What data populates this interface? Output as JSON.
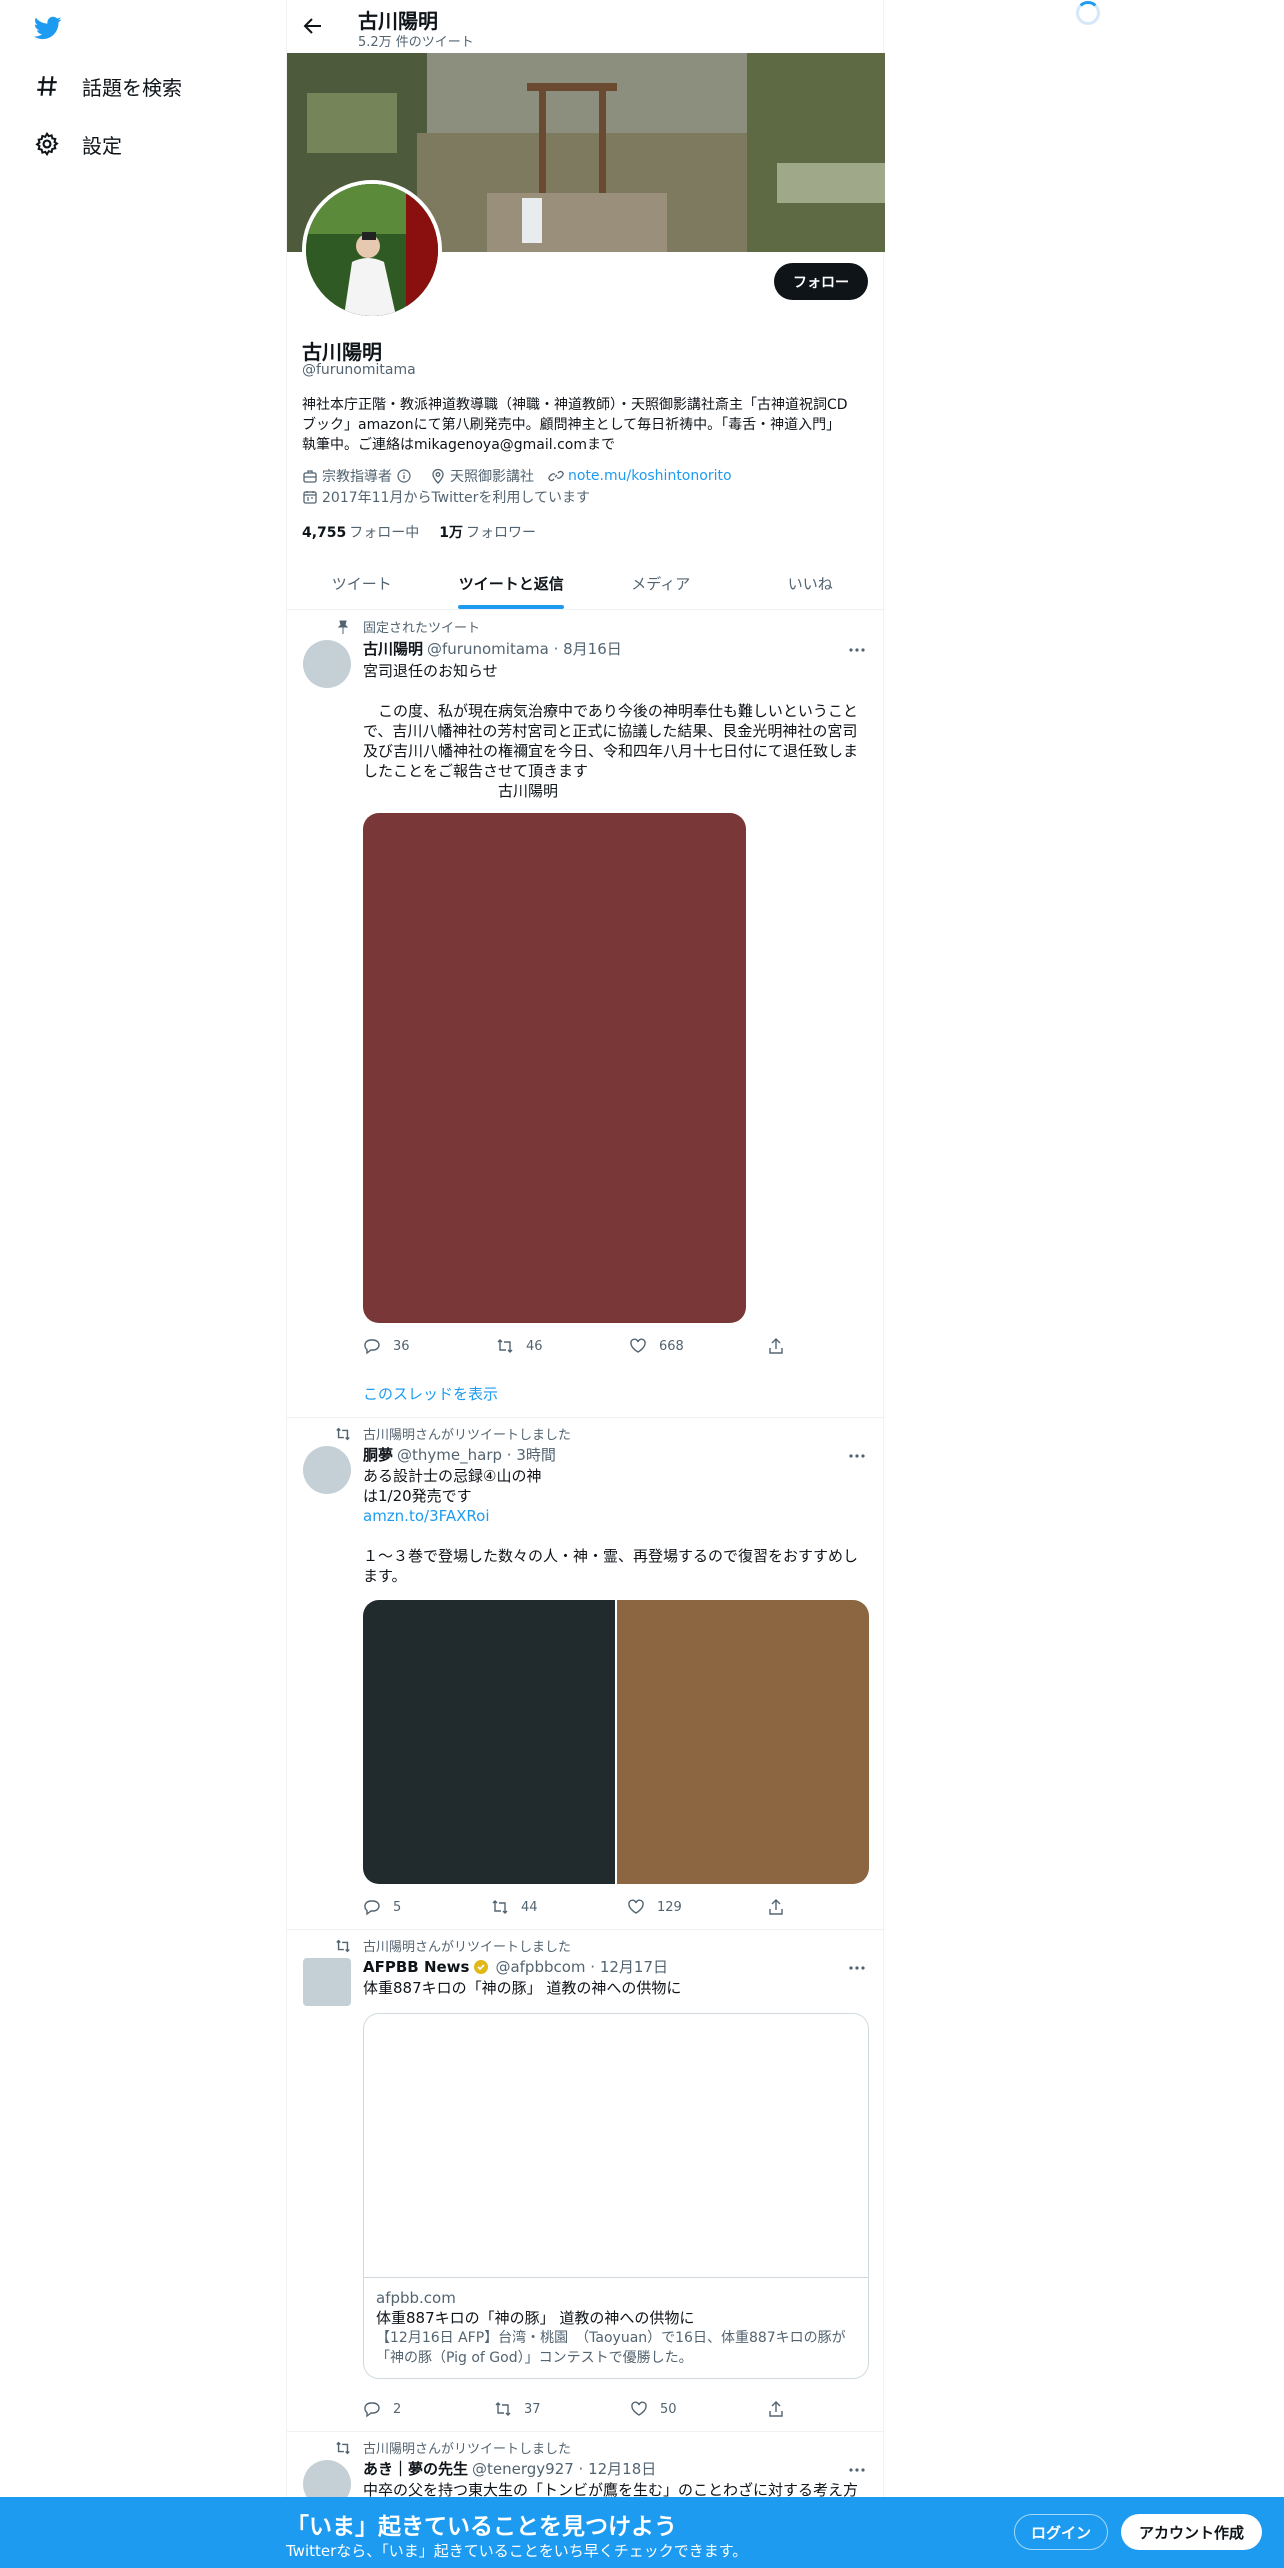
{
  "colors": {
    "accent": "#1d9bf0",
    "text": "#0f1419",
    "muted": "#536471"
  },
  "nav": {
    "items": [
      {
        "label": "話題を検索",
        "icon": "hashtag-icon"
      },
      {
        "label": "設定",
        "icon": "gear-icon"
      }
    ]
  },
  "header": {
    "name": "古川陽明",
    "tweet_count": "5.2万 件のツイート"
  },
  "profile": {
    "follow_label": "フォロー",
    "name": "古川陽明",
    "handle": "@furunomitama",
    "bio": "神社本庁正階・教派神道教導職（神職・神道教師）・天照御影講社斎主「古神道祝詞CDブック」amazonにて第八刷発売中。顧問神主として毎日祈祷中。「毒舌・神道入門」執筆中。ご連絡はmikagenoya@gmail.comまで",
    "category": "宗教指導者",
    "location": "天照御影講社",
    "link": "note.mu/koshintonorito",
    "joined": "2017年11月からTwitterを利用しています",
    "following_count": "4,755",
    "following_label": "フォロー中",
    "followers_count": "1万",
    "followers_label": "フォロワー"
  },
  "tabs": [
    {
      "label": "ツイート",
      "active": false
    },
    {
      "label": "ツイートと返信",
      "active": true
    },
    {
      "label": "メディア",
      "active": false
    },
    {
      "label": "いいね",
      "active": false
    }
  ],
  "tweets": [
    {
      "context": "固定されたツイート",
      "name": "古川陽明",
      "handle_time": "@furunomitama · 8月16日",
      "text": "宮司退任のお知らせ\n\n　この度、私が現在病気治療中であり今後の神明奉仕も難しいということで、吉川八幡神社の芳村宮司と正式に協議した結果、艮金光明神社の宮司及び吉川八幡神社の権禰宜を今日、令和四年八月十七日付にて退任致しましたことをご報告させて頂きます\n　　　　　　　　　古川陽明",
      "media_color": "#7a3737",
      "replies": "36",
      "retweets": "46",
      "likes": "668",
      "thread_link": "このスレッドを表示"
    },
    {
      "context": "古川陽明さんがリツイートしました",
      "name": "胴夢",
      "handle_time": "@thyme_harp · 3時間",
      "text_line1": "ある設計士の忌録④山の神",
      "text_line2": "は1/20発売です",
      "link": "amzn.to/3FAXRoi",
      "text_line3": "１～３巻で登場した数々の人・神・霊、再登場するので復習をおすすめします。",
      "media_colors": [
        "#212a2d",
        "#8b6640"
      ],
      "replies": "5",
      "retweets": "44",
      "likes": "129"
    },
    {
      "context": "古川陽明さんがリツイートしました",
      "name": "AFPBB News",
      "handle_time": "@afpbbcom · 12月17日",
      "text": "体重887キロの「神の豚」 道教の神への供物に",
      "card_domain": "afpbb.com",
      "card_title": "体重887キロの「神の豚」 道教の神への供物に",
      "card_desc": "【12月16日 AFP】台湾・桃園　（Taoyuan）で16日、体重887キロの豚が「神の豚（Pig of God）」コンテストで優勝した。",
      "replies": "2",
      "retweets": "37",
      "likes": "50"
    },
    {
      "context": "古川陽明さんがリツイートしました",
      "name": "あき｜夢の先生",
      "handle_time": "@tenergy927 · 12月18日",
      "text": "中卒の父を持つ東大生の「トンビが鷹を生む」のことわざに対する考え方"
    }
  ],
  "bottom_bar": {
    "title": "「いま」起きていることを見つけよう",
    "subtitle": "Twitterなら、「いま」起きていることをいち早くチェックできます。",
    "login": "ログイン",
    "signup": "アカウント作成"
  }
}
